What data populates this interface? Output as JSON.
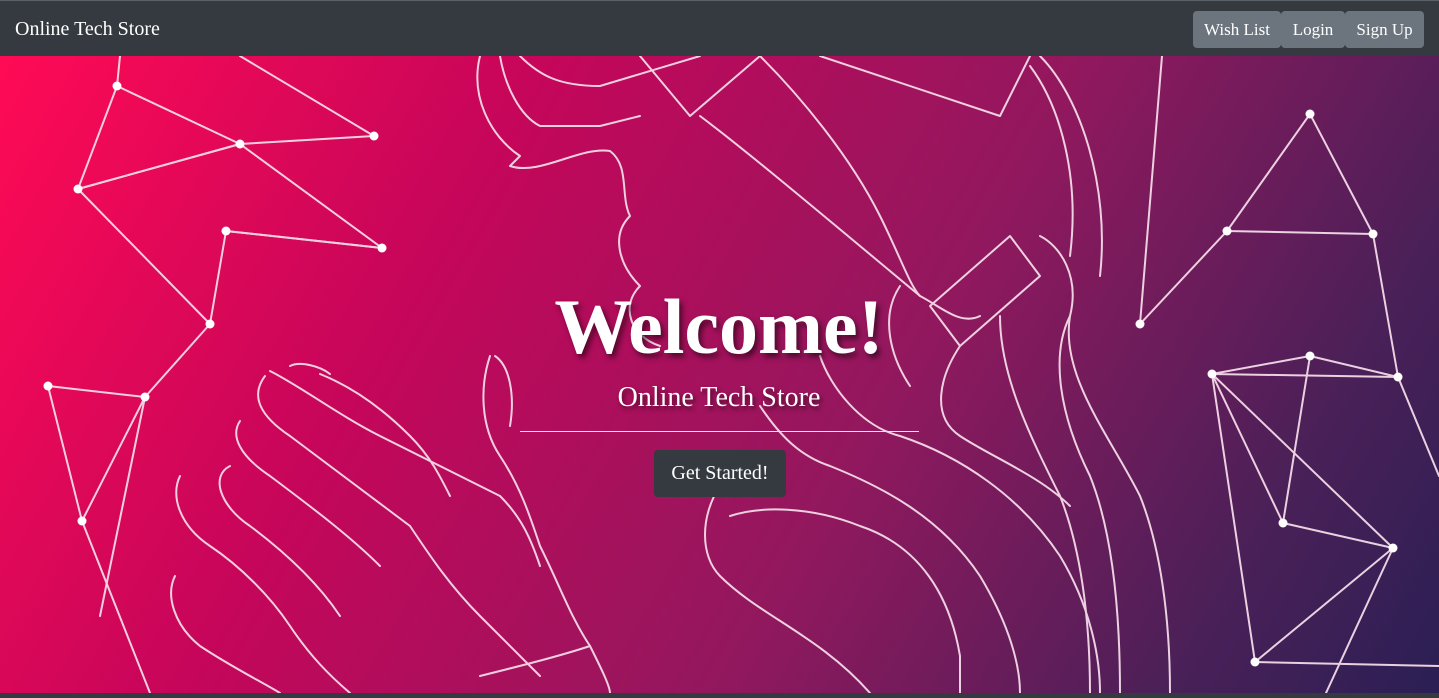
{
  "navbar": {
    "brand": "Online Tech Store",
    "buttons": {
      "wish_list": "Wish List",
      "login": "Login",
      "sign_up": "Sign Up"
    }
  },
  "hero": {
    "title": "Welcome!",
    "subtitle": "Online Tech Store",
    "cta_label": "Get Started!",
    "background_image": "line-art-vr-headset-constellation-illustration",
    "gradient_colors": [
      "#ff0a55",
      "#c6065a",
      "#92185e",
      "#4a2058",
      "#2a1f54"
    ]
  },
  "colors": {
    "navbar_bg": "#343a40",
    "nav_button_bg": "#6c757d",
    "cta_bg": "#343a40",
    "text": "#ffffff"
  }
}
